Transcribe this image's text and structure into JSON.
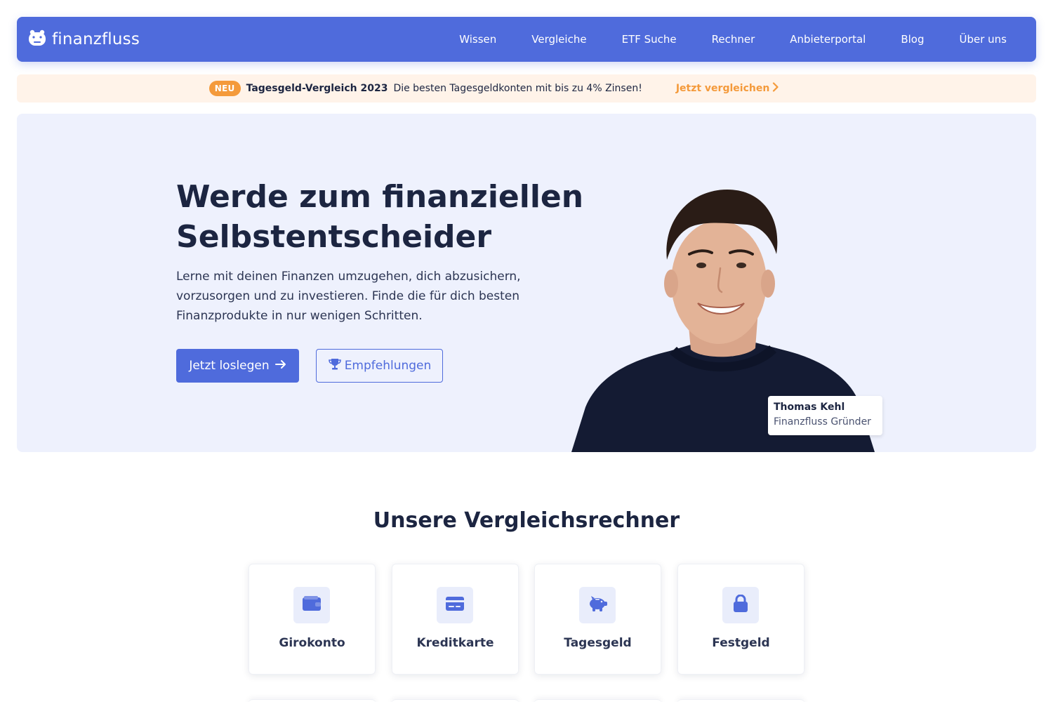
{
  "brand": {
    "name": "finanzfluss",
    "logo_icon": "hippo-icon"
  },
  "nav": {
    "items": [
      "Wissen",
      "Vergleiche",
      "ETF Suche",
      "Rechner",
      "Anbieterportal",
      "Blog",
      "Über uns"
    ]
  },
  "announcement": {
    "badge": "NEU",
    "title": "Tagesgeld-Vergleich 2023",
    "text": "Die besten Tagesgeldkonten mit bis zu 4% Zinsen!",
    "link": "Jetzt vergleichen",
    "link_icon": "chevron-right-icon"
  },
  "hero": {
    "title_line1": "Werde zum finanziellen",
    "title_line2": "Selbstentscheider",
    "subtitle": "Lerne mit deinen Finanzen umzugehen, dich abzusichern, vorzusorgen und zu investieren. Finde die für dich besten Finanzprodukte in nur wenigen Schritten.",
    "primary_button": "Jetzt loslegen",
    "primary_icon": "arrow-right-icon",
    "secondary_button": "Empfehlungen",
    "secondary_icon": "trophy-icon",
    "person_name": "Thomas Kehl",
    "person_role": "Finanzfluss Gründer"
  },
  "comparison": {
    "title": "Unsere Vergleichsrechner",
    "cards": [
      {
        "label": "Girokonto",
        "icon": "wallet-icon"
      },
      {
        "label": "Kreditkarte",
        "icon": "credit-card-icon"
      },
      {
        "label": "Tagesgeld",
        "icon": "piggy-bank-icon"
      },
      {
        "label": "Festgeld",
        "icon": "lock-icon"
      }
    ]
  },
  "colors": {
    "primary": "#4f6bdc",
    "accent_orange": "#f49a3b",
    "text_dark": "#1c2541",
    "hero_bg": "#eef1fd",
    "announce_bg": "#fff3e9"
  }
}
